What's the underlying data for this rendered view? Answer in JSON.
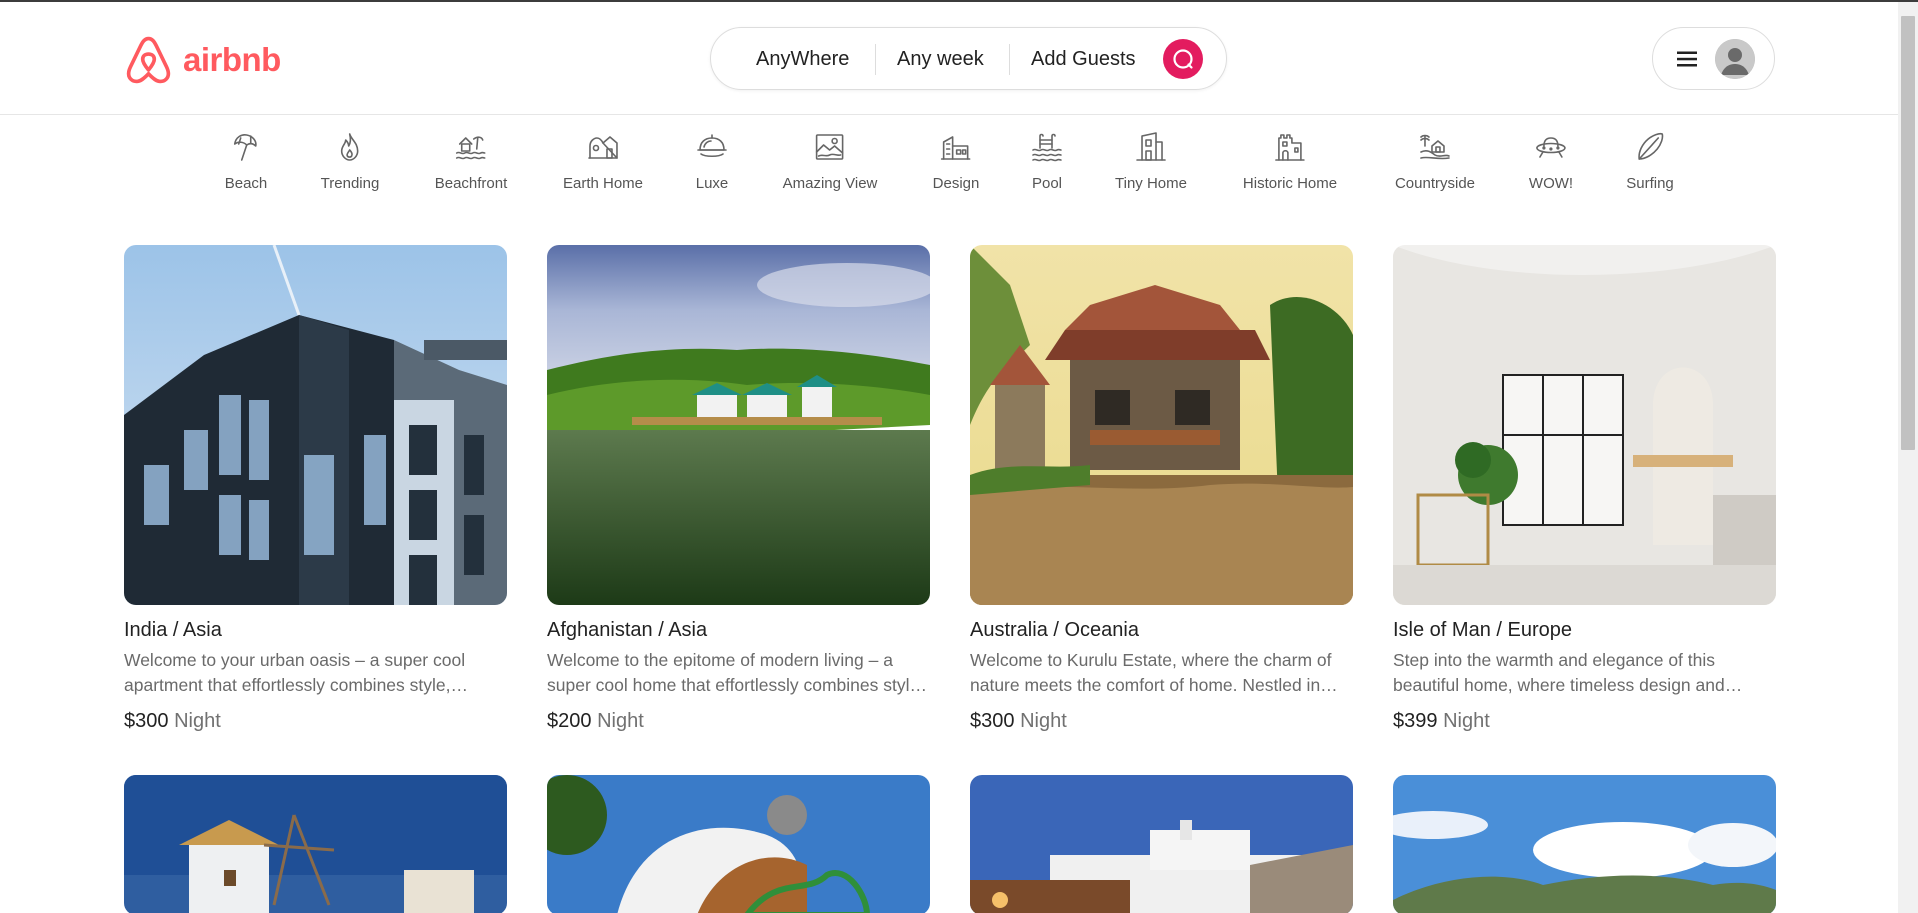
{
  "brand": {
    "name": "airbnb",
    "color": "#ff5a5f"
  },
  "search": {
    "where": "AnyWhere",
    "week": "Any week",
    "guests": "Add Guests",
    "button_color": "#e31c5f",
    "button_icon": "search-icon"
  },
  "user_menu": {
    "menu_icon": "hamburger-icon",
    "avatar_icon": "avatar-icon"
  },
  "categories": [
    {
      "label": "Beach",
      "icon": "beach-umbrella-icon"
    },
    {
      "label": "Trending",
      "icon": "flame-icon"
    },
    {
      "label": "Beachfront",
      "icon": "beachfront-icon"
    },
    {
      "label": "Earth Home",
      "icon": "earth-home-icon"
    },
    {
      "label": "Luxe",
      "icon": "luxe-icon"
    },
    {
      "label": "Amazing View",
      "icon": "amazing-view-icon"
    },
    {
      "label": "Design",
      "icon": "design-icon"
    },
    {
      "label": "Pool",
      "icon": "pool-icon"
    },
    {
      "label": "Tiny Home",
      "icon": "tiny-home-icon"
    },
    {
      "label": "Historic Home",
      "icon": "historic-home-icon"
    },
    {
      "label": "Countryside",
      "icon": "countryside-icon"
    },
    {
      "label": "WOW!",
      "icon": "ufo-icon"
    },
    {
      "label": "Surfing",
      "icon": "surfboard-icon"
    }
  ],
  "listings": [
    {
      "title": "India / Asia",
      "description": "Welcome to your urban oasis – a super cool apartment that effortlessly combines style, comfort, and convenience.",
      "price": "$300",
      "unit": "Night"
    },
    {
      "title": "Afghanistan / Asia",
      "description": "Welcome to the epitome of modern living – a super cool home that effortlessly combines style and comfort.",
      "price": "$200",
      "unit": "Night"
    },
    {
      "title": "Australia / Oceania",
      "description": "Welcome to Kurulu Estate, where the charm of nature meets the comfort of home. Nestled in greenery.",
      "price": "$300",
      "unit": "Night"
    },
    {
      "title": "Isle of Man / Europe",
      "description": "Step into the warmth and elegance of this beautiful home, where timeless design and comfort meet.",
      "price": "$399",
      "unit": "Night"
    }
  ]
}
